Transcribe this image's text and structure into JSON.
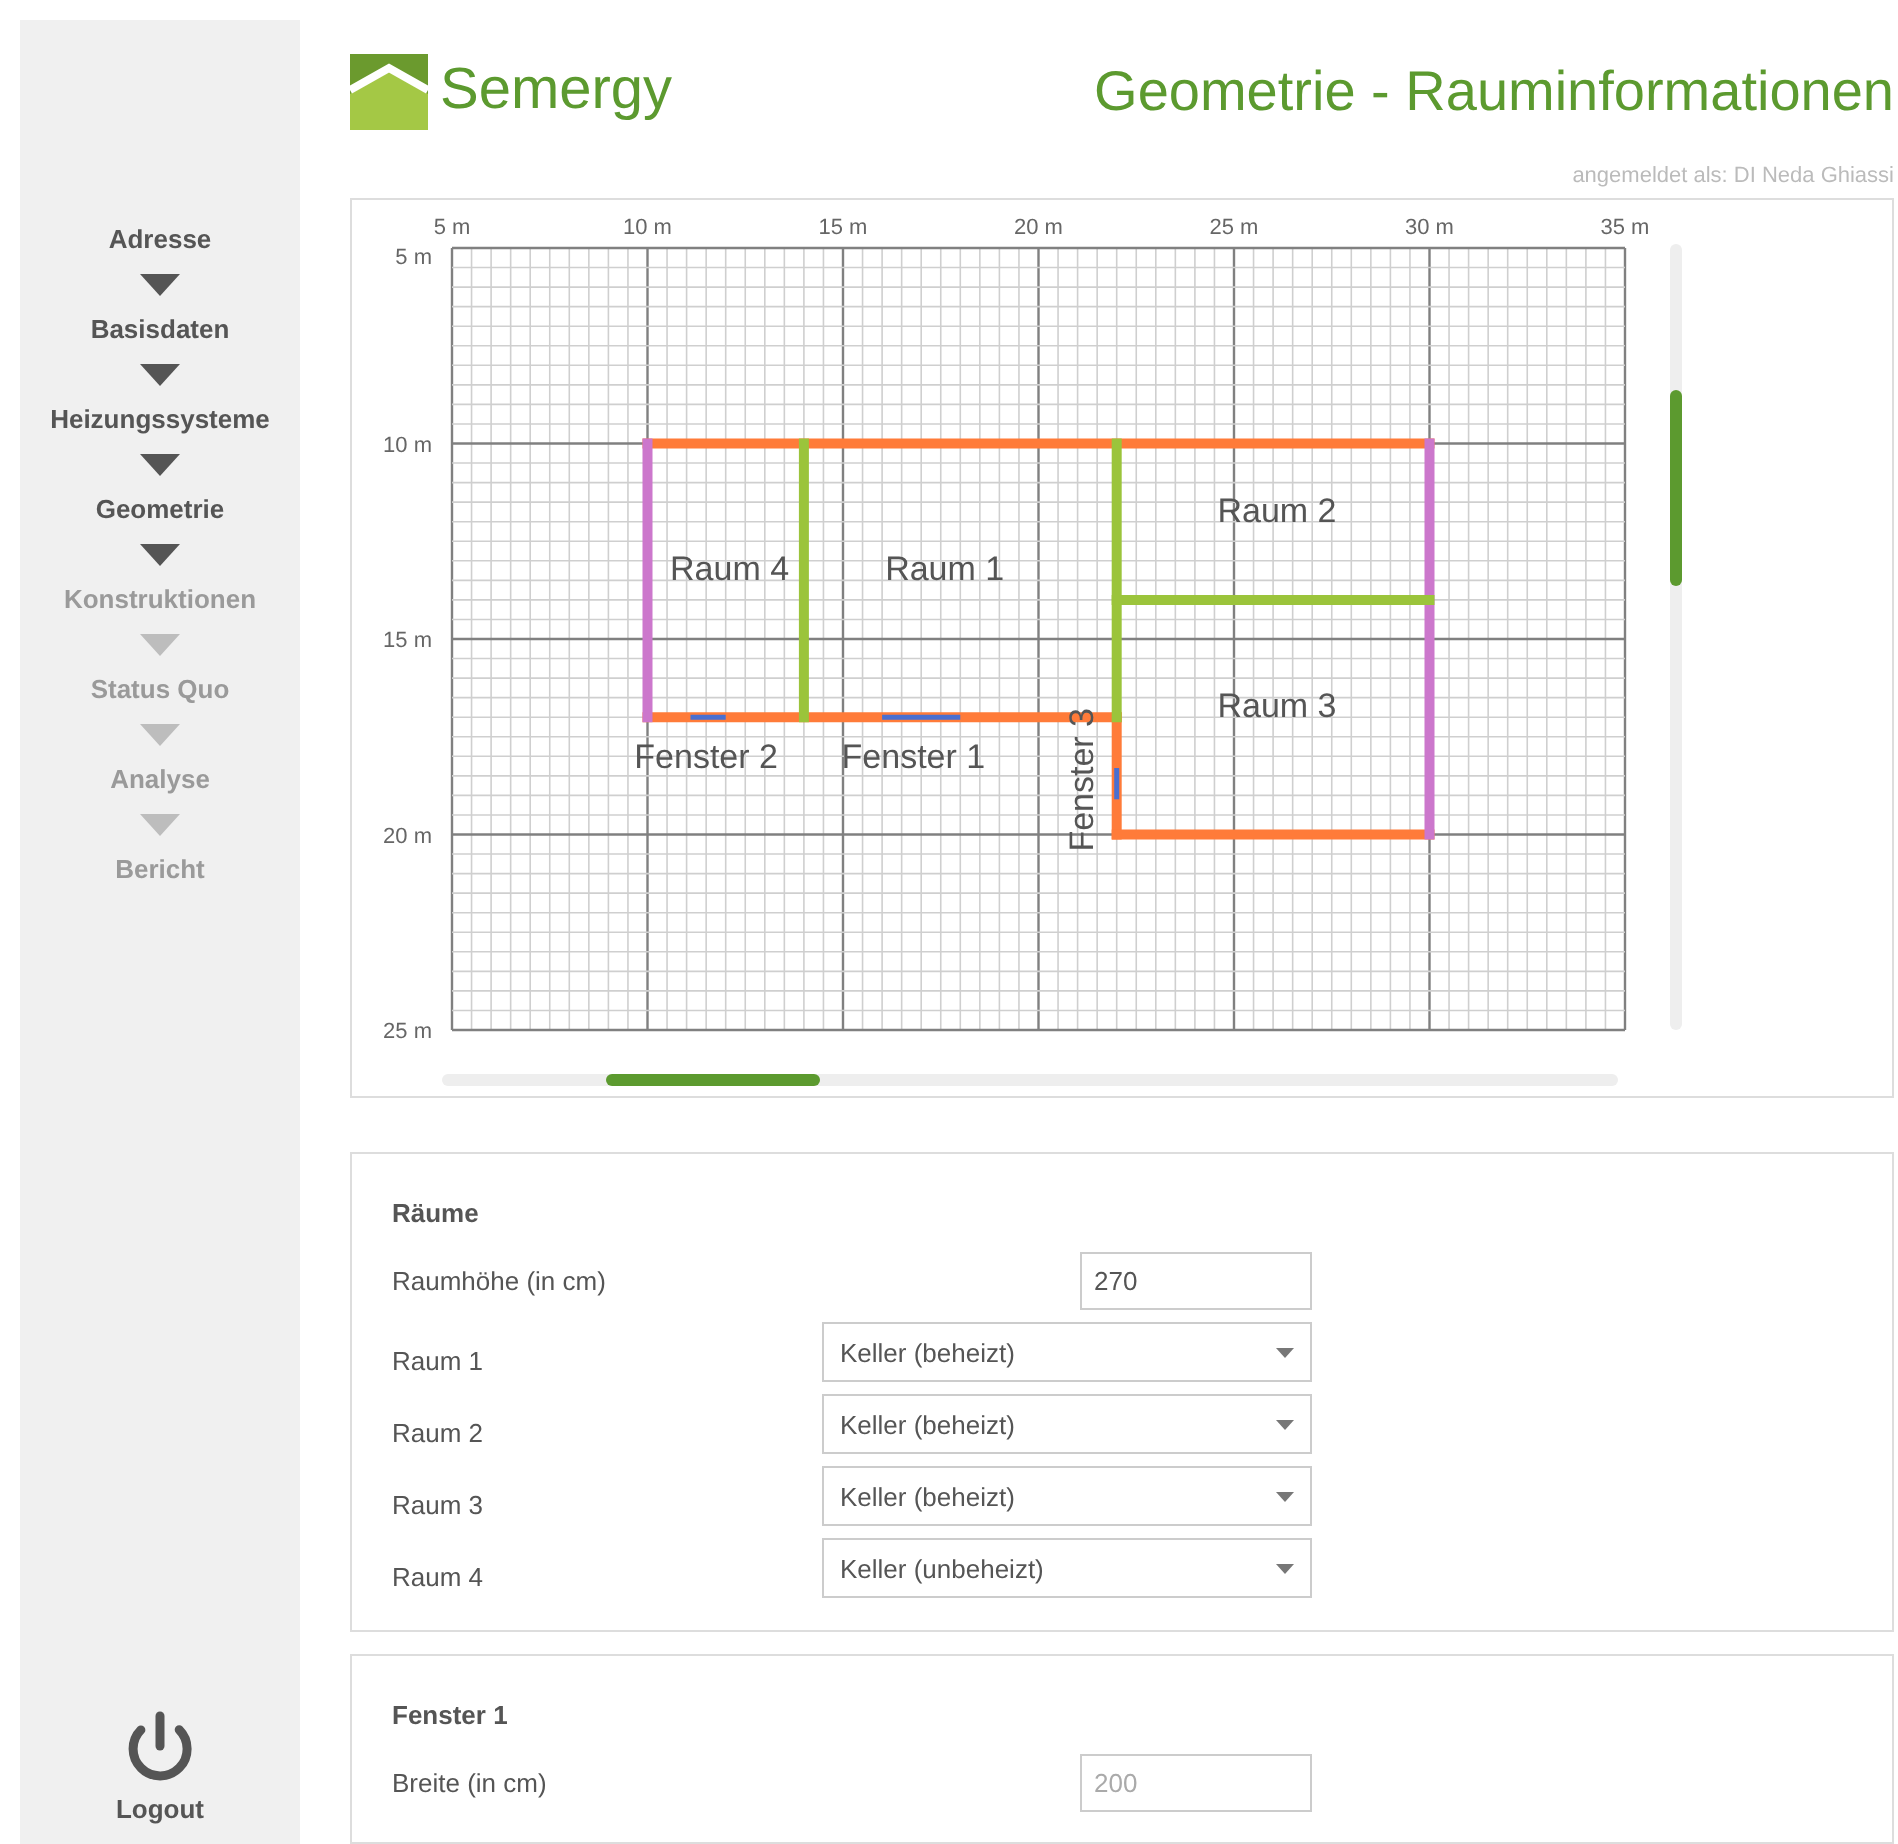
{
  "header": {
    "logo_text": "Semergy",
    "title": "Geometrie - Rauminformationen",
    "user": "angemeldet als: DI Neda Ghiassi"
  },
  "steps": [
    {
      "label": "Adresse",
      "disabled": false
    },
    {
      "label": "Basisdaten",
      "disabled": false
    },
    {
      "label": "Heizungssysteme",
      "disabled": false
    },
    {
      "label": "Geometrie",
      "disabled": false
    },
    {
      "label": "Konstruktionen",
      "disabled": true
    },
    {
      "label": "Status Quo",
      "disabled": true
    },
    {
      "label": "Analyse",
      "disabled": true
    },
    {
      "label": "Bericht",
      "disabled": true
    }
  ],
  "logout": "Logout",
  "plan": {
    "x_ticks": [
      "5 m",
      "10 m",
      "15 m",
      "20 m",
      "25 m",
      "30 m",
      "35 m"
    ],
    "y_ticks": [
      "5 m",
      "10 m",
      "15 m",
      "20 m",
      "25 m"
    ],
    "rooms": [
      {
        "label": "Raum 4"
      },
      {
        "label": "Raum 1"
      },
      {
        "label": "Raum 2"
      },
      {
        "label": "Raum 3"
      }
    ],
    "windows": [
      {
        "label": "Fenster 2"
      },
      {
        "label": "Fenster 1"
      },
      {
        "label": "Fenster 3"
      }
    ]
  },
  "rooms_panel": {
    "title": "Räume",
    "height": {
      "label": "Raumhöhe (in cm)",
      "value": "270"
    },
    "rooms": [
      {
        "label": "Raum 1",
        "value": "Keller (beheizt)"
      },
      {
        "label": "Raum 2",
        "value": "Keller (beheizt)"
      },
      {
        "label": "Raum 3",
        "value": "Keller (beheizt)"
      },
      {
        "label": "Raum 4",
        "value": "Keller (unbeheizt)"
      }
    ]
  },
  "window_panel": {
    "title": "Fenster 1",
    "width": {
      "label": "Breite (in cm)",
      "value": "200",
      "disabled": true
    }
  }
}
